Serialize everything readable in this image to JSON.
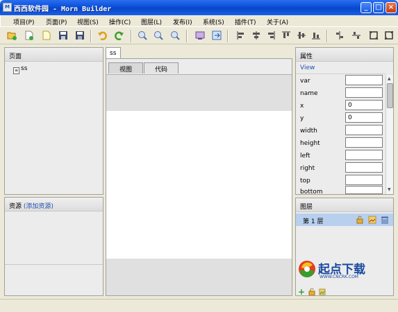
{
  "window": {
    "title": "西西软件园 - Morn Builder",
    "app_icon": "M",
    "buttons": [
      "_",
      "□",
      "×"
    ]
  },
  "menu": [
    "项目(P)",
    "页面(P)",
    "视图(S)",
    "操作(C)",
    "图层(L)",
    "发布(I)",
    "系统(S)",
    "插件(T)",
    "关于(A)"
  ],
  "toolbar_icons": [
    "folder-open-icon",
    "new-page-icon",
    "new-file-icon",
    "save-icon",
    "save-all-icon",
    "undo-icon",
    "redo-icon",
    "zoom-out-icon",
    "zoom-in-icon",
    "zoom-reset-icon",
    "preview-icon",
    "export-icon",
    "align-left-icon",
    "align-center-icon",
    "align-right-icon",
    "align-top-icon",
    "align-middle-icon",
    "align-bottom-icon",
    "distribute-h-icon",
    "distribute-v-icon",
    "same-size-icon",
    "same-width-icon"
  ],
  "pages_panel": {
    "title": "页面",
    "items": [
      {
        "label": "ss"
      }
    ]
  },
  "resources_panel": {
    "title": "资源",
    "add_link": "(添加资源)"
  },
  "editor": {
    "doc_tab": "ss",
    "subtabs": [
      "视图",
      "代码"
    ]
  },
  "properties_panel": {
    "title": "属性",
    "component": "View",
    "fields": [
      {
        "label": "var",
        "value": ""
      },
      {
        "label": "name",
        "value": ""
      },
      {
        "label": "x",
        "value": "0"
      },
      {
        "label": "y",
        "value": "0"
      },
      {
        "label": "width",
        "value": ""
      },
      {
        "label": "height",
        "value": ""
      },
      {
        "label": "left",
        "value": ""
      },
      {
        "label": "right",
        "value": ""
      },
      {
        "label": "top",
        "value": ""
      },
      {
        "label": "bottom",
        "value": ""
      }
    ]
  },
  "layers_panel": {
    "title": "图层",
    "layers": [
      {
        "label": "第 1 层"
      }
    ]
  },
  "watermark": {
    "text": "起点下载",
    "url": "WWW.CNCRK.COM"
  },
  "colors": {
    "title_bar": "#0a4fd8",
    "selection": "#b8cfee",
    "link": "#2050b0"
  }
}
